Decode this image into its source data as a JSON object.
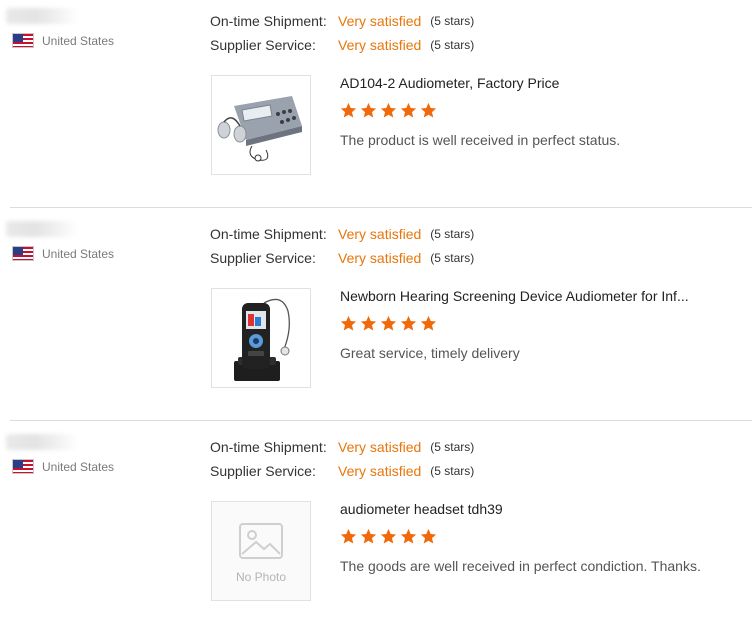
{
  "colors": {
    "accent": "#e8760a",
    "star": "#f06a0c",
    "divider": "#dcdcdc"
  },
  "reviews": [
    {
      "country": "United States",
      "flag_icon": "us-flag-icon",
      "ratings": [
        {
          "label": "On-time Shipment:",
          "value": "Very satisfied",
          "count": "(5 stars)"
        },
        {
          "label": "Supplier Service:",
          "value": "Very satisfied",
          "count": "(5 stars)"
        }
      ],
      "product_title": "AD104-2 Audiometer, Factory Price",
      "product_stars": 5,
      "comment": "The product is well received in perfect status.",
      "image": "audiometer-device"
    },
    {
      "country": "United States",
      "flag_icon": "us-flag-icon",
      "ratings": [
        {
          "label": "On-time Shipment:",
          "value": "Very satisfied",
          "count": "(5 stars)"
        },
        {
          "label": "Supplier Service:",
          "value": "Very satisfied",
          "count": "(5 stars)"
        }
      ],
      "product_title": "Newborn Hearing Screening Device Audiometer for Inf...",
      "product_stars": 5,
      "comment": "Great service, timely delivery",
      "image": "handheld-screener"
    },
    {
      "country": "United States",
      "flag_icon": "us-flag-icon",
      "ratings": [
        {
          "label": "On-time Shipment:",
          "value": "Very satisfied",
          "count": "(5 stars)"
        },
        {
          "label": "Supplier Service:",
          "value": "Very satisfied",
          "count": "(5 stars)"
        }
      ],
      "product_title": "audiometer headset tdh39",
      "product_stars": 5,
      "comment": "The goods are well received in perfect condiction. Thanks.",
      "image": "no-photo",
      "no_photo_label": "No Photo"
    }
  ]
}
